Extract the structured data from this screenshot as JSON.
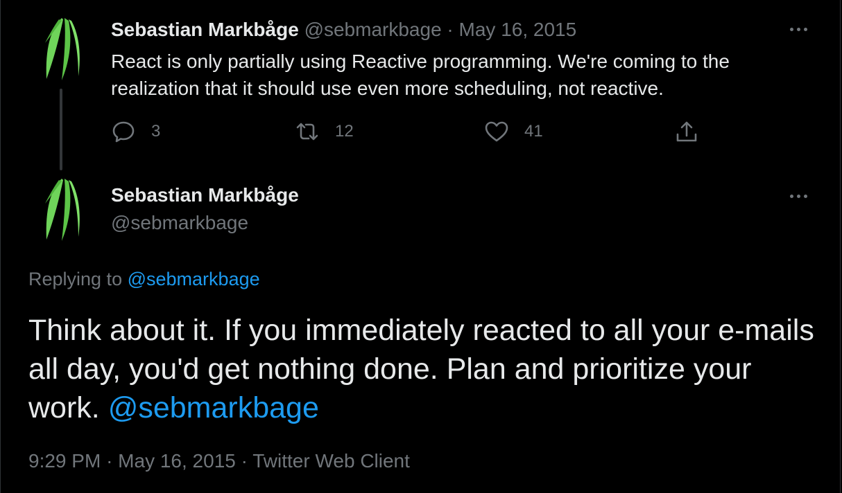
{
  "colors": {
    "background": "#000000",
    "text": "#e7e9ea",
    "muted": "#71767b",
    "link": "#1d9bf0",
    "avatar_leaf": "#6fd45a"
  },
  "icons": {
    "avatar": "green-leaf-avatar-icon",
    "more": "more-options-icon",
    "reply": "reply-icon",
    "retweet": "retweet-icon",
    "like": "like-icon",
    "share": "share-icon"
  },
  "tweet1": {
    "author_name": "Sebastian Markbåge",
    "handle": "@sebmarkbage",
    "separator": "·",
    "date": "May 16, 2015",
    "text": "React is only partially using Reactive programming. We're coming to the realization that it should use even more scheduling, not reactive.",
    "reply_count": "3",
    "retweet_count": "12",
    "like_count": "41"
  },
  "tweet2": {
    "author_name": "Sebastian Markbåge",
    "handle": "@sebmarkbage",
    "replying_to_label": "Replying to",
    "replying_to_handle": "@sebmarkbage",
    "text": "Think about it. If you immediately reacted to all your e-mails all day, you'd get nothing done. Plan and prioritize your work.",
    "mention": "@sebmarkbage",
    "time": "9:29 PM",
    "separator": "·",
    "date": "May 16, 2015",
    "client": "Twitter Web Client"
  }
}
